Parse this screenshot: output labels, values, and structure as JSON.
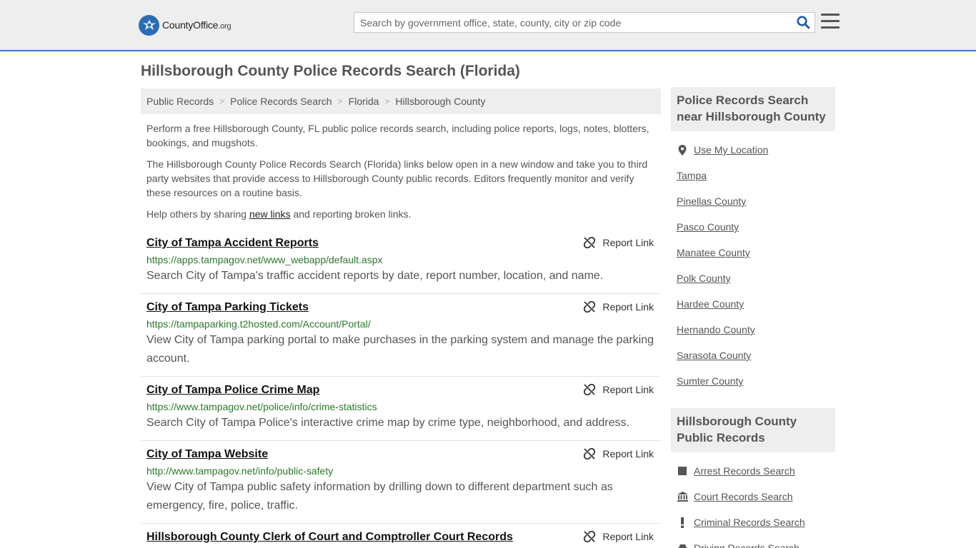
{
  "header": {
    "logo_main": "CountyOffice",
    "logo_tld": ".org",
    "search_placeholder": "Search by government office, state, county, city or zip code"
  },
  "page": {
    "title": "Hillsborough County Police Records Search (Florida)"
  },
  "breadcrumb": [
    "Public Records",
    "Police Records Search",
    "Florida",
    "Hillsborough County"
  ],
  "intro": {
    "p1": "Perform a free Hillsborough County, FL public police records search, including police reports, logs, notes, blotters, bookings, and mugshots.",
    "p2": "The Hillsborough County Police Records Search (Florida) links below open in a new window and take you to third party websites that provide access to Hillsborough County public records. Editors frequently monitor and verify these resources on a routine basis.",
    "p3_pre": "Help others by sharing ",
    "p3_link": "new links",
    "p3_post": " and reporting broken links."
  },
  "report_label": "Report Link",
  "results": [
    {
      "title": "City of Tampa Accident Reports",
      "url": "https://apps.tampagov.net/www_webapp/default.aspx",
      "desc": "Search City of Tampa's traffic accident reports by date, report number, location, and name."
    },
    {
      "title": "City of Tampa Parking Tickets",
      "url": "https://tampaparking.t2hosted.com/Account/Portal/",
      "desc": "View City of Tampa parking portal to make purchases in the parking system and manage the parking account."
    },
    {
      "title": "City of Tampa Police Crime Map",
      "url": "https://www.tampagov.net/police/info/crime-statistics",
      "desc": "Search City of Tampa Police's interactive crime map by crime type, neighborhood, and address."
    },
    {
      "title": "City of Tampa Website",
      "url": "http://www.tampagov.net/info/public-safety",
      "desc": "View City of Tampa public safety information by drilling down to different department such as emergency, fire, police, traffic."
    },
    {
      "title": "Hillsborough County Clerk of Court and Comptroller Court Records",
      "url": "",
      "desc": ""
    }
  ],
  "sidebar": {
    "near_title": "Police Records Search near Hillsborough County",
    "use_location": "Use My Location",
    "near_items": [
      "Tampa",
      "Pinellas County",
      "Pasco County",
      "Manatee County",
      "Polk County",
      "Hardee County",
      "Hernando County",
      "Sarasota County",
      "Sumter County"
    ],
    "public_title": "Hillsborough County Public Records",
    "public_items": [
      {
        "label": "Arrest Records Search",
        "icon": "square-icon"
      },
      {
        "label": "Court Records Search",
        "icon": "courthouse-icon"
      },
      {
        "label": "Criminal Records Search",
        "icon": "exclamation-icon"
      },
      {
        "label": "Driving Records Search",
        "icon": "car-icon"
      }
    ]
  },
  "colors": {
    "accent_blue": "#3b7bbf",
    "link_green": "#2b7a2b",
    "panel_gray": "#eeeeee"
  }
}
